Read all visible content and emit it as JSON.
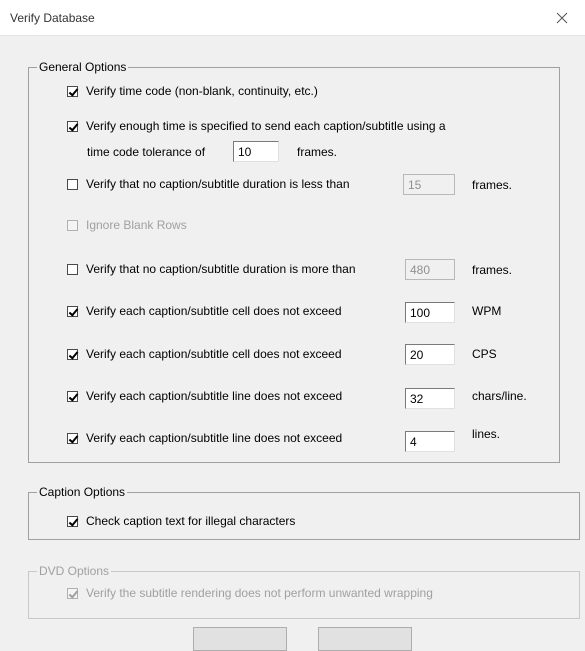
{
  "window": {
    "title": "Verify Database"
  },
  "general": {
    "legend": "General Options",
    "time_code": {
      "checked": true,
      "label": "Verify time code (non-blank, continuity, etc.)"
    },
    "enough_time": {
      "checked": true,
      "label_line1": "Verify enough time is specified to send each caption/subtitle using a",
      "label_line2": "time code tolerance of",
      "value": "10",
      "unit": "frames."
    },
    "min_duration": {
      "checked": false,
      "label": "Verify that no caption/subtitle duration is less than",
      "value": "15",
      "unit": "frames.",
      "enabled": false
    },
    "ignore_blank": {
      "checked": false,
      "label": "Ignore Blank Rows",
      "enabled": false
    },
    "max_duration": {
      "checked": false,
      "label": "Verify that no caption/subtitle duration is more than",
      "value": "480",
      "unit": "frames.",
      "enabled": false
    },
    "wpm": {
      "checked": true,
      "label": "Verify each caption/subtitle cell does not exceed",
      "value": "100",
      "unit": "WPM"
    },
    "cps": {
      "checked": true,
      "label": "Verify each caption/subtitle cell does not exceed",
      "value": "20",
      "unit": "CPS"
    },
    "chars": {
      "checked": true,
      "label": "Verify each caption/subtitle line does not exceed",
      "value": "32",
      "unit": "chars/line."
    },
    "lines": {
      "checked": true,
      "label": "Verify each caption/subtitle line does not exceed",
      "value": "4",
      "unit": "lines."
    }
  },
  "caption": {
    "legend": "Caption Options",
    "illegal_chars": {
      "checked": true,
      "label": "Check caption text for illegal characters"
    }
  },
  "dvd": {
    "legend": "DVD Options",
    "enabled": false,
    "wrapping": {
      "checked": true,
      "label": "Verify the subtitle rendering does not perform unwanted wrapping"
    }
  },
  "buttons": {
    "ok_label": "",
    "cancel_label": ""
  }
}
